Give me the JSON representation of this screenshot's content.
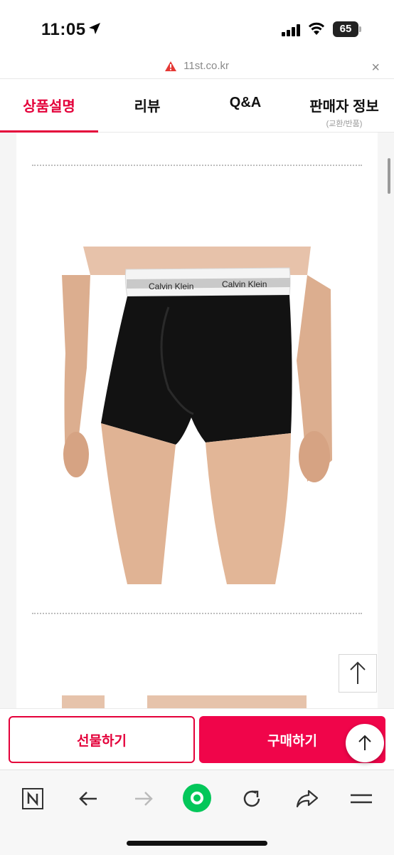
{
  "status_bar": {
    "time": "11:05",
    "battery": "65"
  },
  "url_bar": {
    "url": "11st.co.kr",
    "close_label": "×"
  },
  "tabs": [
    {
      "label": "상품설명",
      "sub": "",
      "active": true
    },
    {
      "label": "리뷰",
      "sub": ""
    },
    {
      "label": "Q&A",
      "sub": ""
    },
    {
      "label": "판매자 정보",
      "sub": "(교환/반품)"
    }
  ],
  "product_image": {
    "brand_waistband": "Calvin Klein"
  },
  "actions": {
    "gift_label": "선물하기",
    "buy_label": "구매하기"
  },
  "colors": {
    "accent": "#e4003a",
    "buy_button": "#f0054a",
    "naver_green": "#03c75a"
  }
}
